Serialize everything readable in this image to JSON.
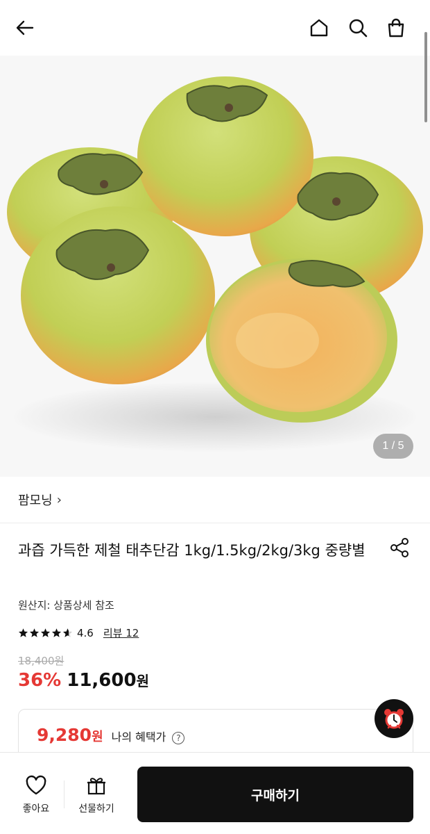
{
  "header": {
    "back_icon": "arrow-left-icon",
    "home_icon": "home-icon",
    "search_icon": "search-icon",
    "cart_icon": "shopping-bag-icon"
  },
  "gallery": {
    "counter": "1 / 5"
  },
  "product": {
    "store_name": "팜모닝",
    "store_chevron": "›",
    "title": "과즙 가득한 제철 태추단감 1kg/1.5kg/2kg/3kg 중량별",
    "origin": "원산지: 상품상세 참조",
    "rating_value": "4.6",
    "rating_fraction": 0.92,
    "review_label": "리뷰 12",
    "original_price": "18,400원",
    "discount": "36%",
    "price": "11,600",
    "price_unit": "원"
  },
  "benefit": {
    "price": "9,280",
    "price_unit": "원",
    "label": "나의 혜택가",
    "help": "?"
  },
  "bottom_bar": {
    "like_label": "좋아요",
    "gift_label": "선물하기",
    "buy_label": "구매하기"
  },
  "colors": {
    "accent_red": "#e53935",
    "buy_button": "#111111"
  }
}
